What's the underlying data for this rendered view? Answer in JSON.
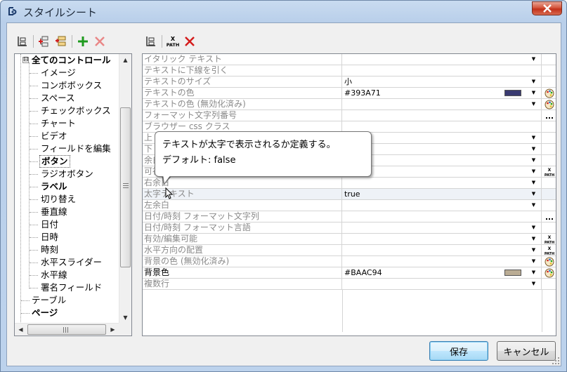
{
  "window": {
    "title": "スタイルシート"
  },
  "tree": {
    "items": [
      {
        "label": "全てのコントロール",
        "bold": true,
        "level": 0
      },
      {
        "label": "イメージ",
        "level": 1
      },
      {
        "label": "コンボボックス",
        "level": 1
      },
      {
        "label": "スペース",
        "level": 1
      },
      {
        "label": "チェックボックス",
        "level": 1
      },
      {
        "label": "チャート",
        "level": 1
      },
      {
        "label": "ビデオ",
        "level": 1
      },
      {
        "label": "フィールドを編集",
        "level": 1
      },
      {
        "label": "ボタン",
        "bold": true,
        "selected": true,
        "level": 1
      },
      {
        "label": "ラジオボタン",
        "level": 1
      },
      {
        "label": "ラベル",
        "bold": true,
        "level": 1
      },
      {
        "label": "切り替え",
        "level": 1
      },
      {
        "label": "垂直線",
        "level": 1
      },
      {
        "label": "日付",
        "level": 1
      },
      {
        "label": "日時",
        "level": 1
      },
      {
        "label": "時刻",
        "level": 1
      },
      {
        "label": "水平スライダー",
        "level": 1
      },
      {
        "label": "水平線",
        "level": 1
      },
      {
        "label": "署名フィールド",
        "level": 1
      },
      {
        "label": "テーブル",
        "level": 0
      },
      {
        "label": "ページ",
        "bold": true,
        "level": 0
      }
    ],
    "expander_symbol": "⊟"
  },
  "grid": {
    "rows": [
      {
        "name": "イタリック テキスト",
        "value": "",
        "dropdown": true,
        "action": ""
      },
      {
        "name": "テキストに下線を引く",
        "value": "",
        "dropdown": false,
        "action": ""
      },
      {
        "name": "テキストのサイズ",
        "value": "小",
        "dropdown": true,
        "action": ""
      },
      {
        "name": "テキストの色",
        "value": "#393A71",
        "dropdown": true,
        "swatch": "#393A71",
        "action": "palette"
      },
      {
        "name": "テキストの色 (無効化済み)",
        "value": "",
        "dropdown": true,
        "action": "palette"
      },
      {
        "name": "フォーマット文字列番号",
        "value": "",
        "dropdown": false,
        "action": "ellipsis"
      },
      {
        "name": "ブラウザー css クラス",
        "value": "",
        "dropdown": false,
        "action": ""
      },
      {
        "name": "上",
        "value": "",
        "dropdown": true,
        "action": ""
      },
      {
        "name": "下",
        "value": "",
        "dropdown": true,
        "action": ""
      },
      {
        "name": "余白",
        "value": "",
        "dropdown": true,
        "action": ""
      },
      {
        "name": "可視",
        "value": "",
        "dropdown": true,
        "action": "xpath"
      },
      {
        "name": "右余白",
        "value": "",
        "dropdown": true,
        "action": ""
      },
      {
        "name": "太字テキスト",
        "value": "true",
        "dropdown": true,
        "action": "",
        "highlight": true
      },
      {
        "name": "左余白",
        "value": "",
        "dropdown": true,
        "action": ""
      },
      {
        "name": "日付/時刻 フォーマット文字列",
        "value": "",
        "dropdown": false,
        "action": "ellipsis"
      },
      {
        "name": "日付/時刻 フォーマット言語",
        "value": "",
        "dropdown": true,
        "action": ""
      },
      {
        "name": "有効/編集可能",
        "value": "",
        "dropdown": true,
        "action": "xpath"
      },
      {
        "name": "水平方向の配置",
        "value": "",
        "dropdown": true,
        "action": "xpath"
      },
      {
        "name": "背景の色 (無効化済み)",
        "value": "",
        "dropdown": true,
        "action": "palette",
        "marker": true
      },
      {
        "name": "背景色",
        "value": "#BAAC94",
        "dropdown": true,
        "swatch": "#BAAC94",
        "action": "palette",
        "dark": true
      },
      {
        "name": "複数行",
        "value": "",
        "dropdown": true,
        "action": ""
      }
    ]
  },
  "tooltip": {
    "line1": "テキストが太字で表示されるか定義する。",
    "line2": "デフォルト: false"
  },
  "buttons": {
    "save": "保存",
    "cancel": "キャンセル"
  },
  "icons": {
    "xpath_top": "X",
    "xpath_bottom": "PATH",
    "hscroll_grip": "III"
  }
}
